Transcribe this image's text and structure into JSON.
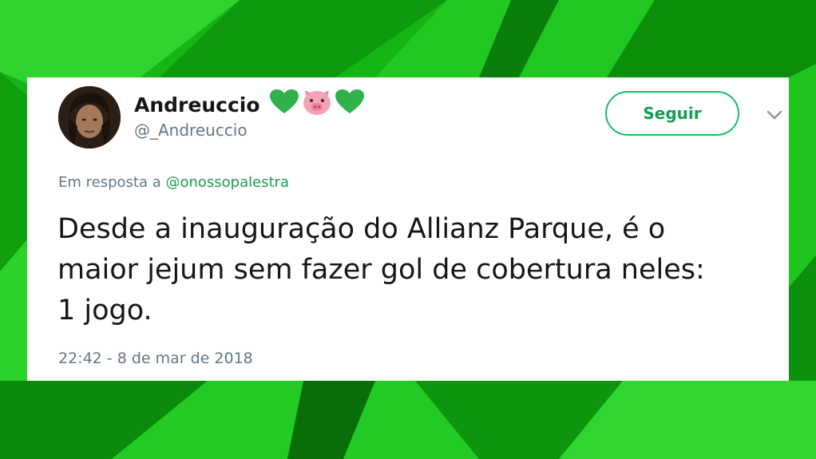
{
  "tweet": {
    "display_name": "Andreuccio",
    "name_emojis": [
      "green-heart-icon",
      "pig-face-icon",
      "green-heart-icon"
    ],
    "handle": "@_Andreuccio",
    "follow_label": "Seguir",
    "reply_prefix": "Em resposta a",
    "reply_mention": "@onossopalestra",
    "text_lines": [
      "Desde a inauguração do Allianz Parque, é o",
      "maior jejum sem fazer gol de cobertura neles:",
      "1 jogo."
    ],
    "timestamp": "22:42 - 8 de mar de 2018"
  },
  "colors": {
    "background": "#14b814",
    "follow_green": "#17bf63",
    "mention_green": "#1a9e52",
    "heart_green": "#2fb24c",
    "pig_pink": "#f4a3b5"
  }
}
